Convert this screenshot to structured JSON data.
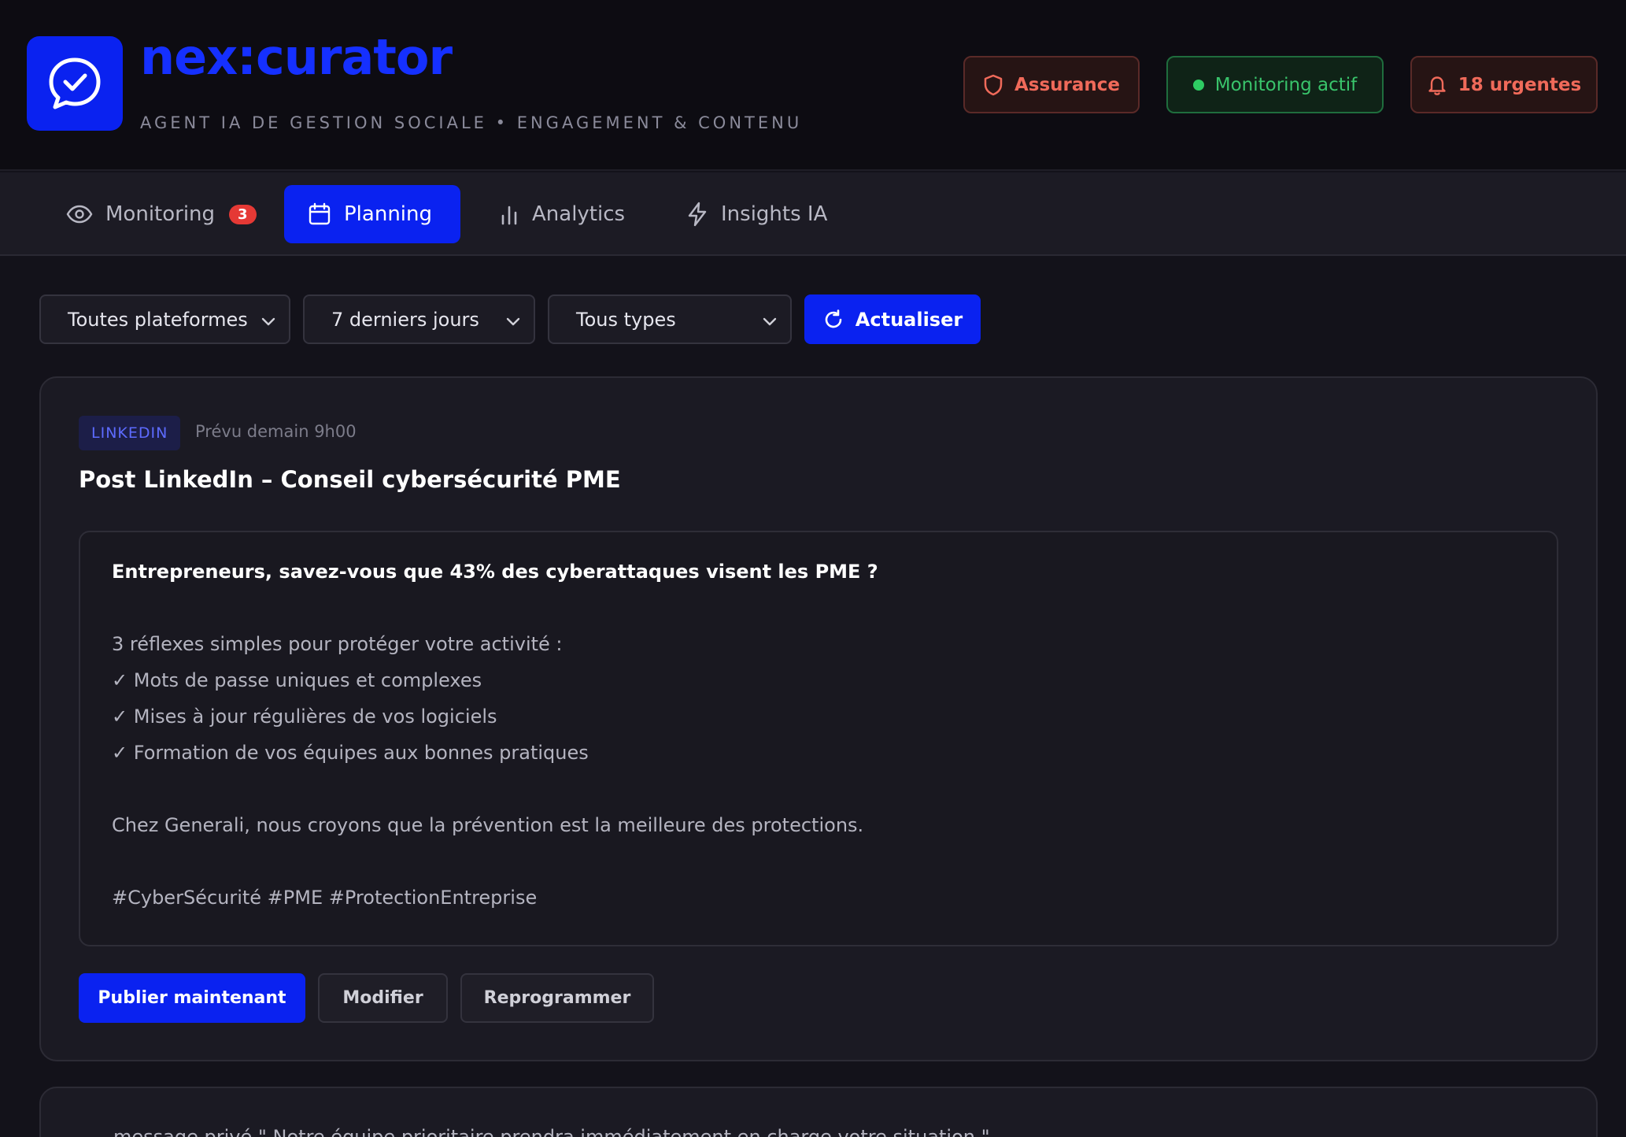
{
  "header": {
    "title": "nex:curator",
    "subtitle": "AGENT IA DE GESTION SOCIALE • ENGAGEMENT & CONTENU",
    "logo_icon": "chat-check-icon",
    "badges": {
      "assurance": "Assurance",
      "monitoring": "Monitoring actif",
      "urgentes": "18 urgentes"
    }
  },
  "tabs": [
    {
      "label": "Monitoring",
      "icon": "eye-icon",
      "badge": "3"
    },
    {
      "label": "Planning",
      "icon": "calendar-icon",
      "active": true
    },
    {
      "label": "Analytics",
      "icon": "bar-chart-icon"
    },
    {
      "label": "Insights IA",
      "icon": "lightning-icon"
    }
  ],
  "filters": {
    "platform": "Toutes plateformes",
    "period": "7 derniers jours",
    "type": "Tous types",
    "refresh": "Actualiser"
  },
  "post": {
    "platform": "LINKEDIN",
    "schedule": "Prévu demain 9h00",
    "title": "Post LinkedIn – Conseil cybersécurité PME",
    "headline": "Entrepreneurs, savez-vous que 43% des cyberattaques visent les PME ?",
    "intro": "3 réflexes simples pour protéger votre activité :",
    "items": [
      "✓ Mots de passe uniques et complexes",
      "✓ Mises à jour régulières de vos logiciels",
      "✓ Formation de vos équipes aux bonnes pratiques"
    ],
    "closing": "Chez Generali, nous croyons que la prévention est la meilleure des protections.",
    "hashtags": "#CyberSécurité #PME #ProtectionEntreprise",
    "actions": {
      "publish": "Publier maintenant",
      "modify": "Modifier",
      "reschedule": "Reprogrammer"
    }
  },
  "next_card": {
    "text": "message privé.\" Notre équipe prioritaire prendra immédiatement en charge votre situation.\""
  },
  "colors": {
    "accent": "#0a22f0",
    "success": "#39c46b",
    "danger": "#f06a5a"
  }
}
